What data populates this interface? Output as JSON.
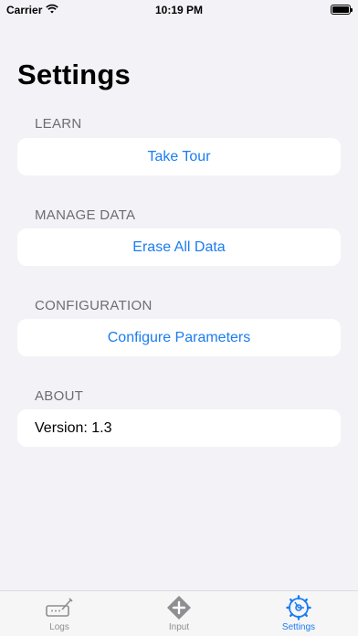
{
  "status_bar": {
    "carrier": "Carrier",
    "time": "10:19 PM",
    "icons": [
      "wifi-icon",
      "battery-icon"
    ]
  },
  "page": {
    "title": "Settings"
  },
  "sections": {
    "learn": {
      "header": "LEARN",
      "button": "Take Tour"
    },
    "manage_data": {
      "header": "MANAGE DATA",
      "button": "Erase All Data"
    },
    "configuration": {
      "header": "CONFIGURATION",
      "button": "Configure Parameters"
    },
    "about": {
      "header": "ABOUT",
      "version": "Version: 1.3"
    }
  },
  "tab_bar": {
    "tabs": [
      {
        "label": "Logs",
        "icon": "logbook-icon"
      },
      {
        "label": "Input",
        "icon": "plus-circle-icon"
      },
      {
        "label": "Settings",
        "icon": "gear-icon"
      }
    ],
    "active_tab": "Settings"
  },
  "colors": {
    "accent": "#1c7cf0",
    "background": "#f2f2f7",
    "section_header": "#6d6d72",
    "inactive_tab": "#8e8e93"
  }
}
